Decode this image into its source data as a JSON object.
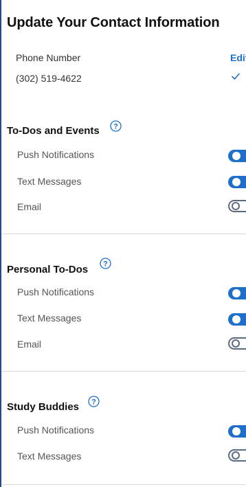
{
  "header": {
    "title": "Update Your Contact Information"
  },
  "contact": {
    "phone_label": "Phone Number",
    "phone_value": "(302) 519-4622",
    "edit_label": "Edit"
  },
  "sections": [
    {
      "title": "To-Dos and Events",
      "rows": [
        {
          "label": "Push Notifications",
          "enabled": true
        },
        {
          "label": "Text Messages",
          "enabled": true
        },
        {
          "label": "Email",
          "enabled": false
        }
      ]
    },
    {
      "title": "Personal To-Dos",
      "rows": [
        {
          "label": "Push Notifications",
          "enabled": true
        },
        {
          "label": "Text Messages",
          "enabled": true
        },
        {
          "label": "Email",
          "enabled": false
        }
      ]
    },
    {
      "title": "Study Buddies",
      "rows": [
        {
          "label": "Push Notifications",
          "enabled": true
        },
        {
          "label": "Text Messages",
          "enabled": false
        }
      ]
    }
  ],
  "icons": {
    "check": "check-icon",
    "help": "help-icon"
  },
  "colors": {
    "accent": "#1f6fc8",
    "frame_border": "#1f4e8c",
    "toggle_off_border": "#5a6a80",
    "divider": "#d9d9d9"
  }
}
